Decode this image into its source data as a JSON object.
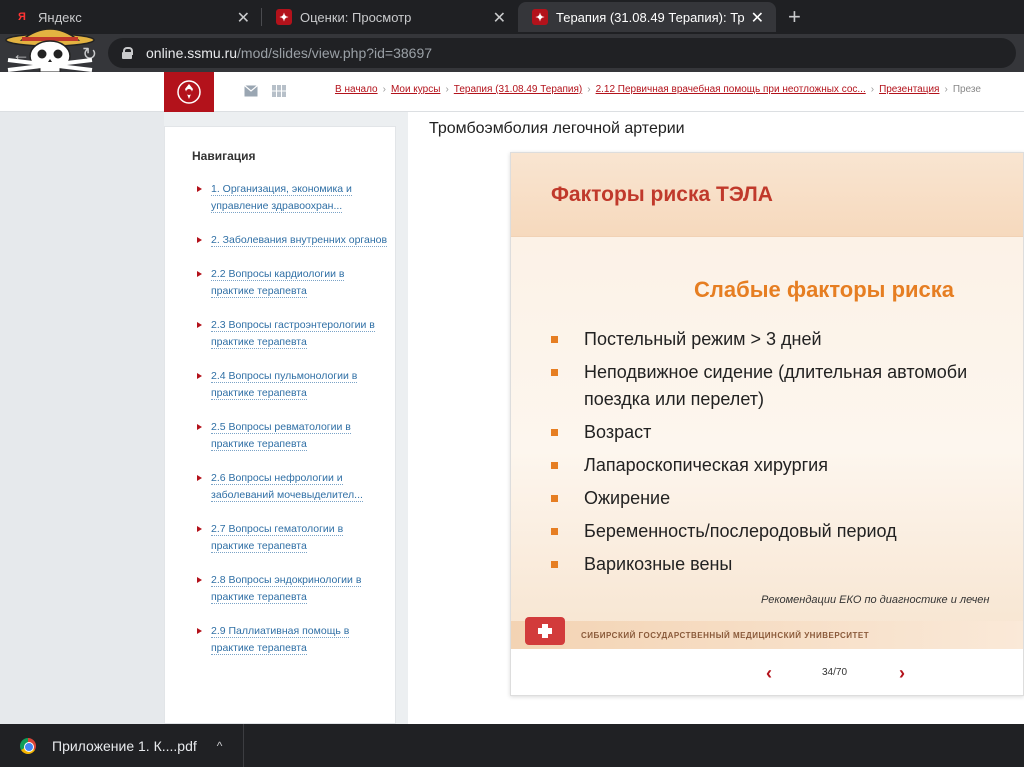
{
  "browser": {
    "tabs": [
      {
        "title": "Яндекс",
        "icon": "yandex-icon",
        "active": false
      },
      {
        "title": "Оценки: Просмотр",
        "icon": "ssmu-icon",
        "active": false
      },
      {
        "title": "Терапия (31.08.49 Терапия): Тр",
        "icon": "ssmu-icon",
        "active": true
      }
    ],
    "new_tab": "+",
    "url_host": "online.ssmu.ru",
    "url_path": "/mod/slides/view.php?id=38697"
  },
  "header": {
    "breadcrumb": [
      "В начало",
      "Мои курсы",
      "Терапия (31.08.49 Терапия)",
      "2.12 Первичная врачебная помощь при неотложных сос...",
      "Презентация"
    ],
    "breadcrumb_last": "Презе"
  },
  "nav": {
    "title": "Навигация",
    "items": [
      "1. Организация, экономика и управление здравоохран...",
      "2. Заболевания внутренних органов",
      "2.2 Вопросы кардиологии в практике терапевта",
      "2.3 Вопросы гастроэнтерологии в практике терапевта",
      "2.4 Вопросы пульмонологии в практике терапевта",
      "2.5 Вопросы ревматологии в практике терапевта",
      "2.6 Вопросы нефрологии и заболеваний мочевыделител...",
      "2.7 Вопросы гематологии в практике терапевта",
      "2.8 Вопросы эндокринологии в практике терапевта",
      "2.9 Паллиативная помощь в практике терапевта"
    ]
  },
  "main": {
    "page_title": "Тромбоэмболия легочной артерии",
    "slide": {
      "title": "Факторы риска ТЭЛА",
      "subtitle": "Слабые факторы риска",
      "bullets": [
        "Постельный режим > 3 дней",
        "Неподвижное сидение (длительная автомоби",
        "поездка или перелет)",
        "Возраст",
        "Лапароскопическая хирургия",
        "Ожирение",
        "Беременность/послеродовый  период",
        "Варикозные вены"
      ],
      "recommendation": "Рекомендации ЕКО по диагностике и лечен",
      "university": "СИБИРСКИЙ ГОСУДАРСТВЕННЫЙ МЕДИЦИНСКИЙ УНИВЕРСИТЕТ"
    },
    "pager": {
      "text": "34/70",
      "prev": "‹",
      "next": "›"
    }
  },
  "download": {
    "filename": "Приложение 1. К....pdf",
    "caret": "^"
  },
  "colors": {
    "brand_red": "#b3121b",
    "accent_orange": "#e67e22",
    "link_blue": "#2f6fa5"
  }
}
